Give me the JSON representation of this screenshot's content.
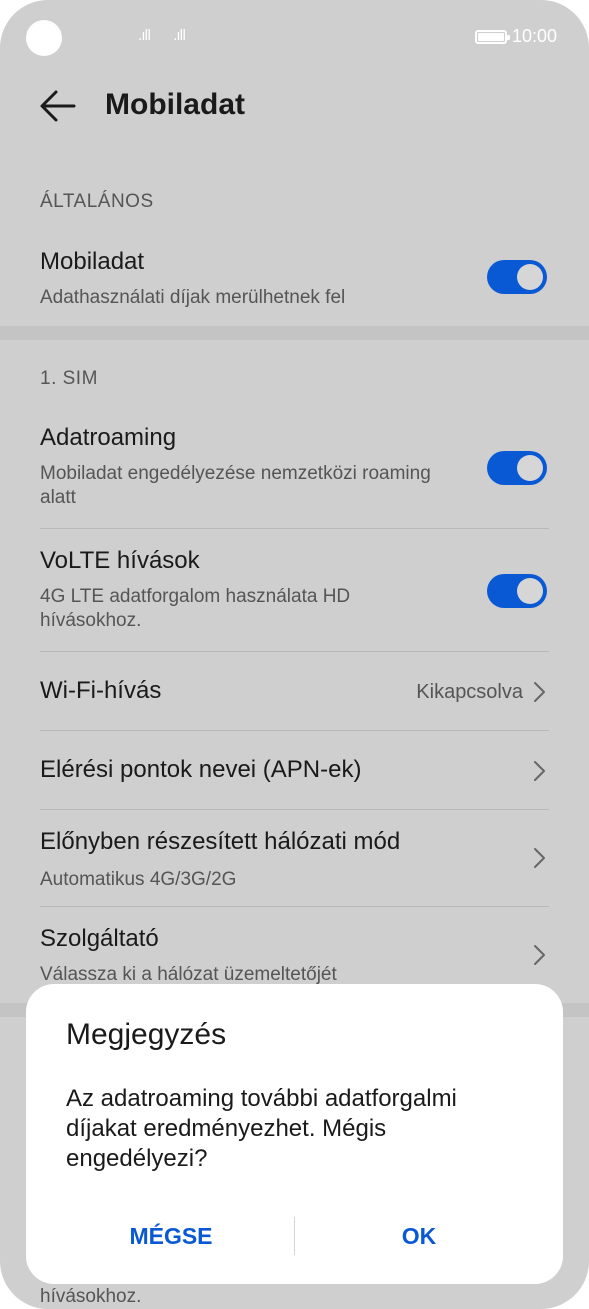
{
  "status_bar": {
    "signal_1": ".ıll",
    "signal_2": ".ıll",
    "time": "10:00"
  },
  "header": {
    "title": "Mobiladat"
  },
  "sections": {
    "general_label": "ÁLTALÁNOS",
    "sim_label": "1. SIM"
  },
  "mobile_data": {
    "title": "Mobiladat",
    "subtitle": "Adathasználati díjak merülhetnek fel",
    "enabled": true
  },
  "data_roaming": {
    "title": "Adatroaming",
    "subtitle": "Mobiladat engedélyezése nemzetközi roaming alatt",
    "enabled": true
  },
  "volte": {
    "title": "VoLTE hívások",
    "subtitle": "4G LTE adatforgalom használata HD hívásokhoz.",
    "enabled": true
  },
  "wifi_calling": {
    "title": "Wi-Fi-hívás",
    "value": "Kikapcsolva"
  },
  "apn": {
    "title": "Elérési pontok nevei (APN-ek)"
  },
  "network_mode": {
    "title": "Előnyben részesített hálózati mód",
    "subtitle": "Automatikus 4G/3G/2G"
  },
  "operator": {
    "title": "Szolgáltató",
    "subtitle": "Válassza ki a hálózat üzemeltetőjét"
  },
  "dialog": {
    "title": "Megjegyzés",
    "message": "Az adatroaming további adatforgalmi díjakat eredményezhet. Mégis engedélyezi?",
    "cancel_label": "MÉGSE",
    "ok_label": "OK"
  },
  "bottom_peek": "hívásokhoz.",
  "colors": {
    "accent": "#0a59d4",
    "background": "#cfcfcf",
    "dialog": "#ffffff"
  }
}
